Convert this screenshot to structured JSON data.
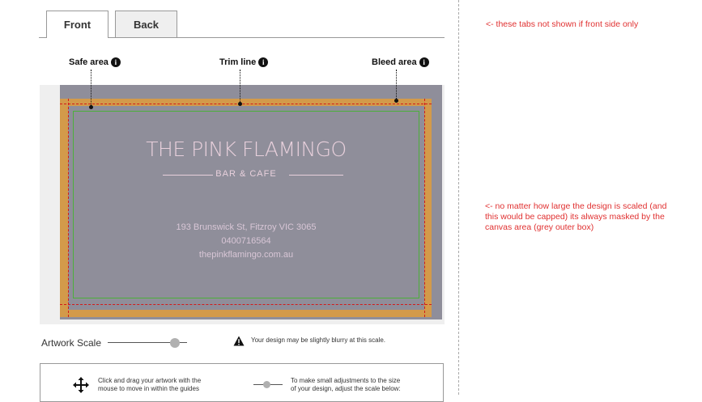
{
  "tabs": {
    "front": "Front",
    "back": "Back"
  },
  "guides": {
    "safe_area": "Safe area",
    "trim_line": "Trim line",
    "bleed_area": "Bleed area",
    "info_glyph": "i"
  },
  "card": {
    "title": "THE PINK FLAMINGO",
    "subtitle": "BAR & CAFE",
    "address": "193 Brunswick St, Fitzroy VIC 3065",
    "phone": "0400716564",
    "website": "thepinkflamingo.com.au"
  },
  "scale": {
    "label": "Artwork Scale",
    "level": 0.85,
    "warning": "Your design may be slightly blurry at this scale."
  },
  "instructions": {
    "drag_line1": "Click and drag your artwork with the",
    "drag_line2": "mouse to move in within the guides",
    "scale_line1": "To make small adjustments to the size",
    "scale_line2": "of your design, adjust the scale below:"
  },
  "notes": {
    "tabs_note": "<- these tabs not shown if front side only",
    "mask_line1": "<- no matter how large the design is scaled (and",
    "mask_line2": "this would be capped) its always masked by the",
    "mask_line3": "canvas area (grey outer box)"
  },
  "colors": {
    "bleed": "#d39a4a",
    "trim": "#d21a1a",
    "safe": "#4caf3a",
    "canvas": "#8f8e9a",
    "note": "#e03030"
  }
}
